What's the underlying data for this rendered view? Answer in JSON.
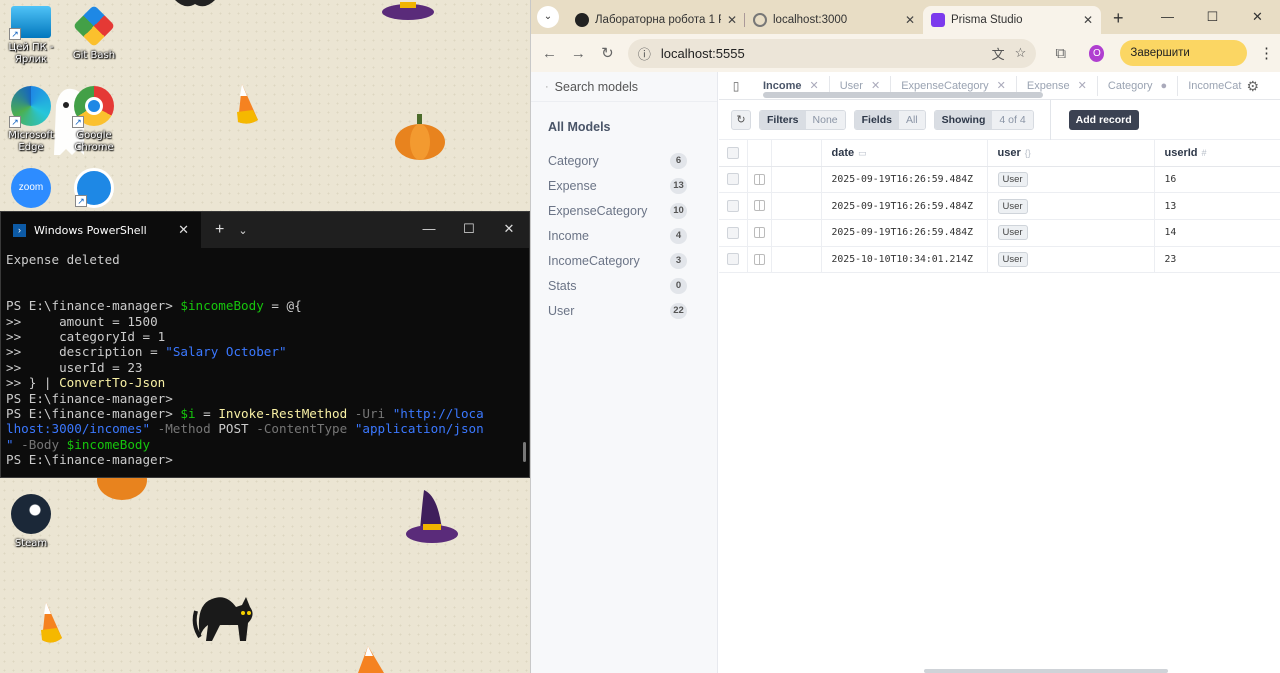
{
  "desktop": {
    "icons": [
      {
        "label": "Цей ПК - Ярлик"
      },
      {
        "label": "Git Bash"
      },
      {
        "label": "Microsoft Edge"
      },
      {
        "label": "Google Chrome"
      },
      {
        "label": "zoom"
      },
      {
        "label": ""
      },
      {
        "label": "Steam"
      }
    ]
  },
  "powershell": {
    "tab_title": "Windows PowerShell",
    "lines": {
      "l1": "Expense deleted",
      "p1": "PS E:\\finance-manager> ",
      "v_income": "$incomeBody",
      "eq_open": " = @{",
      "cont": ">>     ",
      "amount": "amount = 1500",
      "category": "categoryId = 1",
      "desc_key": "description = ",
      "desc_val": "\"Salary October\"",
      "userid": "userId = 23",
      "cont_close": ">> } | ",
      "convert": "ConvertTo-Json",
      "p2": "PS E:\\finance-manager>",
      "p3": "PS E:\\finance-manager> ",
      "v_i": "$i",
      "eq": " = ",
      "invoke": "Invoke-RestMethod",
      "uri_flag": " -Uri ",
      "uri_1": "\"http://loca",
      "uri_2": "lhost:3000/incomes\"",
      "method_flag": " -Method ",
      "method": "POST",
      "ctype_flag": " -ContentType ",
      "ctype_1": "\"application/json",
      "ctype_2": "\"",
      "body_flag": " -Body ",
      "body_val": "$incomeBody",
      "p4": "PS E:\\finance-manager>"
    }
  },
  "browser": {
    "tabs": [
      {
        "title": "Лабораторна робота 1 Р"
      },
      {
        "title": "localhost:3000"
      },
      {
        "title": "Prisma Studio"
      }
    ],
    "url": "localhost:5555",
    "profile_initial": "O",
    "update_label": "Завершити оновлення"
  },
  "prisma": {
    "search_placeholder": "Search models",
    "all_models": "All Models",
    "models": [
      {
        "name": "Category",
        "count": "6"
      },
      {
        "name": "Expense",
        "count": "13"
      },
      {
        "name": "ExpenseCategory",
        "count": "10"
      },
      {
        "name": "Income",
        "count": "4"
      },
      {
        "name": "IncomeCategory",
        "count": "3"
      },
      {
        "name": "Stats",
        "count": "0"
      },
      {
        "name": "User",
        "count": "22"
      }
    ],
    "open_tabs": [
      "Income",
      "User",
      "ExpenseCategory",
      "Expense",
      "Category",
      "IncomeCat"
    ],
    "toolbar": {
      "filters": "Filters",
      "none": "None",
      "fields": "Fields",
      "all": "All",
      "showing": "Showing",
      "showing_count": "4 of 4",
      "add_record": "Add record"
    },
    "columns": [
      "date",
      "user",
      "userId"
    ],
    "rows": [
      {
        "date": "2025-09-19T16:26:59.484Z",
        "user": "User",
        "userId": "16"
      },
      {
        "date": "2025-09-19T16:26:59.484Z",
        "user": "User",
        "userId": "13"
      },
      {
        "date": "2025-09-19T16:26:59.484Z",
        "user": "User",
        "userId": "14"
      },
      {
        "date": "2025-10-10T10:34:01.214Z",
        "user": "User",
        "userId": "23"
      }
    ]
  },
  "colors": {
    "accent_update": "#fbd663",
    "ps_yellow": "#f9f1a5",
    "ps_green": "#16c60c",
    "ps_blue": "#3b78ff"
  }
}
